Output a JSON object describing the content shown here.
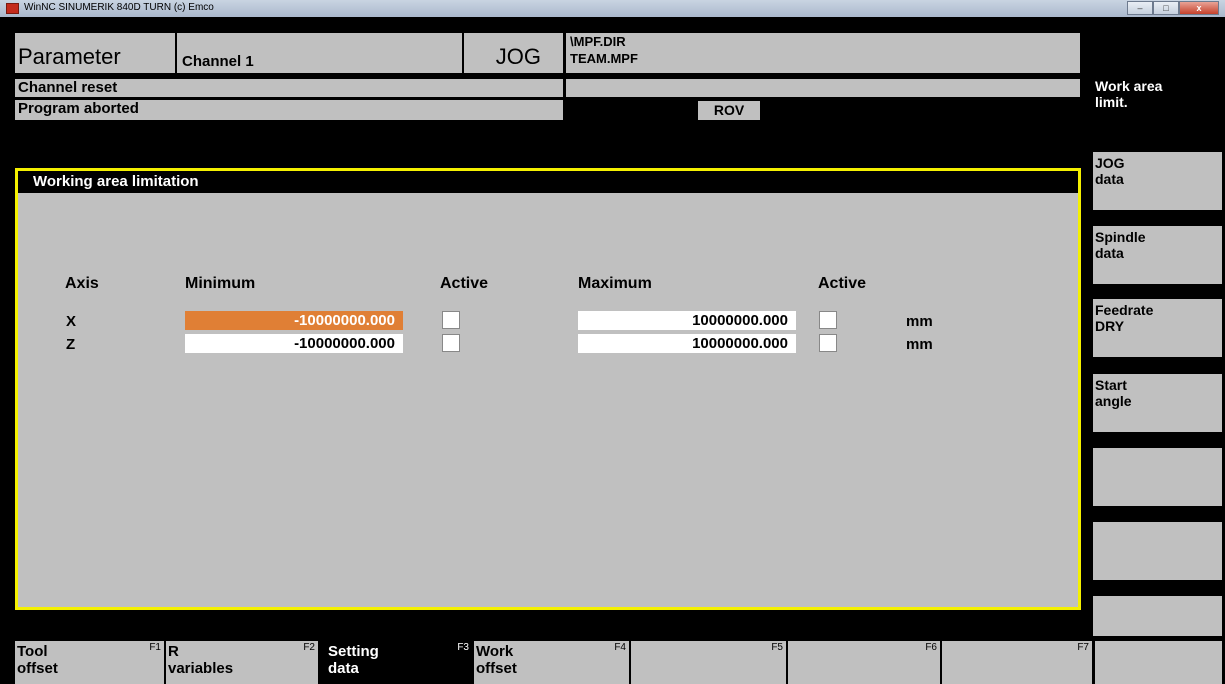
{
  "window": {
    "title": "WinNC SINUMERIK 840D TURN (c) Emco",
    "btn_min": "–",
    "btn_max": "□",
    "btn_close": "x"
  },
  "header": {
    "area": "Parameter",
    "channel": "Channel 1",
    "mode": "JOG",
    "path_dir": "\\MPF.DIR",
    "path_file": "TEAM.MPF"
  },
  "status": {
    "line1": "Channel reset",
    "line2": "Program aborted",
    "rov": "ROV"
  },
  "panel": {
    "title": "Working area limitation",
    "headers": {
      "axis": "Axis",
      "minimum": "Minimum",
      "active1": "Active",
      "maximum": "Maximum",
      "active2": "Active"
    },
    "rows": [
      {
        "axis": "X",
        "min": "-10000000.000",
        "min_active": false,
        "max": "10000000.000",
        "max_active": false,
        "unit": "mm"
      },
      {
        "axis": "Z",
        "min": "-10000000.000",
        "min_active": false,
        "max": "10000000.000",
        "max_active": false,
        "unit": "mm"
      }
    ]
  },
  "right_softkeys": [
    {
      "label": "Work area\nlimit."
    },
    {
      "label": "JOG\ndata"
    },
    {
      "label": "Spindle\ndata"
    },
    {
      "label": "Feedrate\nDRY"
    },
    {
      "label": "Start\nangle"
    },
    {
      "label": ""
    },
    {
      "label": ""
    },
    {
      "label": ""
    }
  ],
  "bottom_softkeys": [
    {
      "label": "Tool\noffset",
      "fkey": "F1"
    },
    {
      "label": "R\nvariables",
      "fkey": "F2"
    },
    {
      "label": "Setting\ndata",
      "fkey": "F3"
    },
    {
      "label": "Work\noffset",
      "fkey": "F4"
    },
    {
      "label": "",
      "fkey": "F5"
    },
    {
      "label": "",
      "fkey": "F6"
    },
    {
      "label": "",
      "fkey": "F7"
    },
    {
      "label": "",
      "fkey": ""
    }
  ],
  "colors": {
    "accent_border": "#f4f000",
    "selected_field": "#e07f35",
    "panel_bg": "#c0c0c0"
  }
}
